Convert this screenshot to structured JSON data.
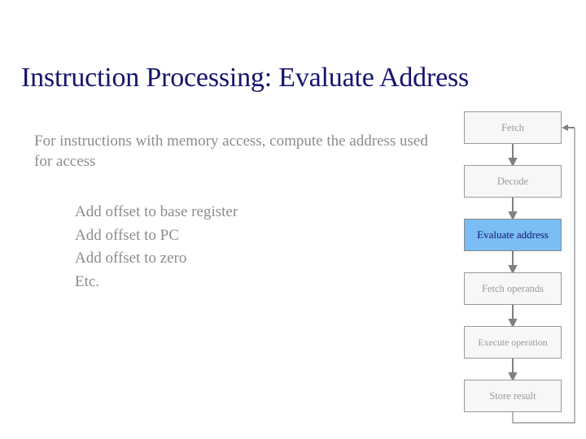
{
  "slide": {
    "title": "Instruction Processing: Evaluate Address",
    "title_color": "#14146e",
    "background_color": "#ffffff",
    "body_text_color": "#8c8c8c"
  },
  "body": {
    "bullets": [
      {
        "level": 1,
        "text": "For instructions with memory access, compute the address used for access"
      }
    ],
    "sub_bullets": [
      {
        "level": 2,
        "text": "Add offset to base register"
      },
      {
        "level": 2,
        "text": "Add offset to PC"
      },
      {
        "level": 2,
        "text": "Add offset to zero"
      },
      {
        "level": 2,
        "text": "Etc."
      }
    ]
  },
  "flowchart": {
    "accent_color": "#79bdf4",
    "box_fill": "#f7f7f7",
    "box_border": "#9a9a9a",
    "box_text_color": "#9a9a9a",
    "highlight_text_color": "#14146e",
    "connector_color": "#808080",
    "boxes": [
      {
        "label": "Fetch",
        "highlighted": false
      },
      {
        "label": "Decode",
        "highlighted": false
      },
      {
        "label": "Evaluate address",
        "highlighted": true
      },
      {
        "label": "Fetch operands",
        "highlighted": false
      },
      {
        "label": "Execute operation",
        "highlighted": false
      },
      {
        "label": "Store result",
        "highlighted": false
      }
    ],
    "feedback_loop": {
      "from": "Store result",
      "to": "Fetch",
      "description": "loop back to Fetch"
    }
  }
}
